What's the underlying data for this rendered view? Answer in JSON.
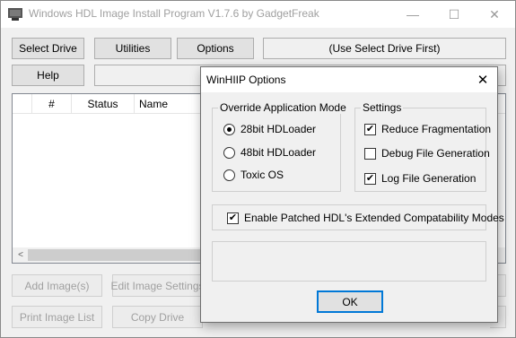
{
  "main": {
    "title": "Windows HDL Image Install Program V1.7.6 by GadgetFreak",
    "caption": {
      "minimize": "—",
      "maximize": "☐",
      "close": "✕"
    },
    "toolbar": {
      "select_drive": "Select Drive",
      "utilities": "Utilities",
      "options": "Options",
      "help": "Help",
      "drive_status": "(Use Select Drive First)",
      "help_field": ""
    },
    "list": {
      "columns": [
        "#",
        "Status",
        "Name"
      ],
      "partial_column_tail": "r",
      "scroll_left": "<"
    },
    "bottom": {
      "add_images": "Add Image(s)",
      "edit_image_settings": "Edit Image Settings",
      "print_image_list": "Print Image List",
      "copy_drive": "Copy Drive"
    }
  },
  "dialog": {
    "title": "WinHIIP Options",
    "close": "✕",
    "mode_group": {
      "label": "Override Application Mode",
      "options": [
        {
          "label": "28bit HDLoader",
          "selected": true
        },
        {
          "label": "48bit HDLoader",
          "selected": false
        },
        {
          "label": "Toxic OS",
          "selected": false
        }
      ]
    },
    "settings_group": {
      "label": "Settings",
      "options": [
        {
          "label": "Reduce Fragmentation",
          "checked": true
        },
        {
          "label": "Debug File Generation",
          "checked": false
        },
        {
          "label": "Log File Generation",
          "checked": true
        }
      ]
    },
    "patched": {
      "label": "Enable Patched HDL's Extended Compatability Modes",
      "checked": true
    },
    "status_text": "",
    "ok": "OK"
  }
}
